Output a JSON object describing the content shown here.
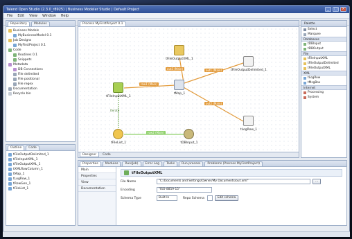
{
  "window": {
    "title": "Talend Open Studio (2.3.0_r8925) | Business Modeler Studio | Default Project"
  },
  "menu": [
    "File",
    "Edit",
    "View",
    "Window",
    "Help"
  ],
  "repository": {
    "tabs": [
      "Repository",
      "Modules"
    ],
    "items": [
      {
        "label": "Business Models",
        "icon": "folder-icon",
        "indent": 0
      },
      {
        "label": "MyBusinessModel 0.1",
        "icon": "job-icon",
        "indent": 1
      },
      {
        "label": "Job Designs",
        "icon": "folder-icon",
        "indent": 0
      },
      {
        "label": "MyFirstProject 0.1",
        "icon": "job-icon",
        "indent": 1
      },
      {
        "label": "Code",
        "icon": "code-icon",
        "indent": 0
      },
      {
        "label": "Routines 0.1",
        "icon": "code-icon",
        "indent": 1
      },
      {
        "label": "Snippets",
        "icon": "code-icon",
        "indent": 1
      },
      {
        "label": "Metadata",
        "icon": "meta-icon",
        "indent": 0
      },
      {
        "label": "DB Connections",
        "icon": "meta-icon",
        "indent": 1
      },
      {
        "label": "File delimited",
        "icon": "doc-icon",
        "indent": 1
      },
      {
        "label": "File positional",
        "icon": "doc-icon",
        "indent": 1
      },
      {
        "label": "File regex",
        "icon": "doc-icon",
        "indent": 1
      },
      {
        "label": "Documentation",
        "icon": "doc-icon",
        "indent": 0
      },
      {
        "label": "Recycle bin",
        "icon": "bin-icon",
        "indent": 0
      }
    ]
  },
  "outline": {
    "tabs": [
      "Outline",
      "Code"
    ],
    "items": [
      "tFileOutputDelimited_1",
      "tFileInputXML_1",
      "tFileOutputXML_1",
      "tXMLRowColumn_1",
      "tMap_1",
      "tLogRow_1",
      "tRowGen_1",
      "tFileList_1"
    ]
  },
  "designer": {
    "tab": "Process MyFirstProject 0.1",
    "bottom_tabs": [
      "Designer",
      "Code"
    ],
    "components": {
      "input_xml": "tFileInputXML_1",
      "map": "tMap_1",
      "output_xml": "tFileOutputXML_1",
      "output_delim": "tFileOutputDelimited_1",
      "file_list": "tFileList_1",
      "db": "tDBInput_1",
      "log": "tLogRow_1"
    },
    "links": {
      "main": "row1 (Main)",
      "out1": "out1 (Main)",
      "out2": "out2 (Main)",
      "out3": "out3 (Main)",
      "iterate": "Iterate",
      "row2": "row2 (Main)"
    }
  },
  "palette": {
    "title": "Palette",
    "tools": [
      "Select",
      "Marquee"
    ],
    "categories": [
      {
        "name": "Databases",
        "items": [
          "tDBInput",
          "tDBOutput"
        ]
      },
      {
        "name": "File",
        "items": [
          "tFileInputXML",
          "tFileOutputDelimited",
          "tFileOutputXML"
        ]
      },
      {
        "name": "XML",
        "items": [
          "tLogRow",
          "tMsgBox"
        ]
      },
      {
        "name": "Internet",
        "items": [
          "Processing",
          "System"
        ]
      }
    ]
  },
  "properties": {
    "tabs": [
      "Properties",
      "Modules",
      "Run(Job)",
      "Error Log",
      "Tasks",
      "Run process",
      "Problems (Process MyFirstProject)"
    ],
    "vtabs": [
      "Main",
      "Properties",
      "View",
      "Documentation"
    ],
    "component": "tFileOutputXML",
    "filename_label": "File Name",
    "filename_value": "\"C:/Documents and Settings/Owner/My Documents/out.xml\"",
    "encoding_label": "Encoding",
    "encoding_value": "\"ISO-8859-15\"",
    "schema_label": "Schema Type",
    "schema_value": "Built-In",
    "repository_schema_label": "Repo Schema",
    "edit_schema_button": "Edit schema"
  }
}
